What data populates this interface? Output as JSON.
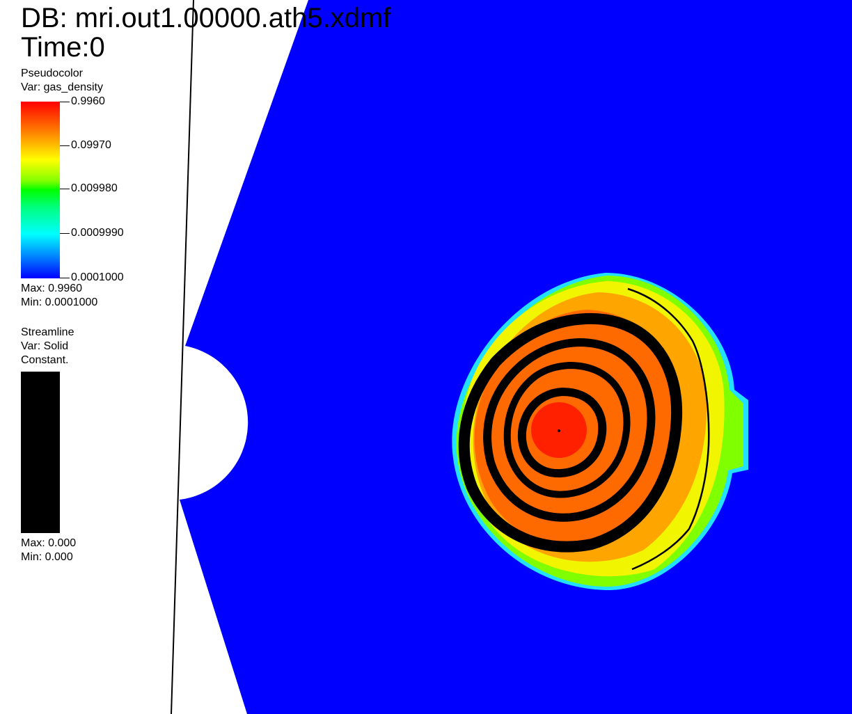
{
  "header": {
    "db": "DB: mri.out1.00000.ath5.xdmf",
    "time": "Time:0"
  },
  "pseudocolor": {
    "title": "Pseudocolor",
    "var": "Var: gas_density",
    "ticks": [
      "0.9960",
      "0.09970",
      "0.009980",
      "0.0009990",
      "0.0001000"
    ],
    "max": "Max:  0.9960",
    "min": "Min:  0.0001000"
  },
  "streamline": {
    "title": "Streamline",
    "var": "Var: Solid",
    "mode": "Constant.",
    "max": "Max:  0.000",
    "min": "Min:  0.000"
  },
  "colors": {
    "background_field": "#0000ff",
    "vortex_core": "#ff2000",
    "streamline": "#000000",
    "page": "#ffffff"
  }
}
